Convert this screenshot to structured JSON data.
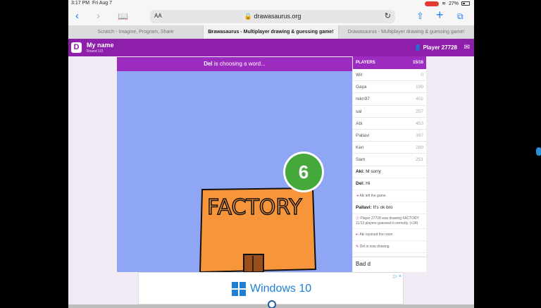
{
  "statusbar": {
    "time": "3:17 PM",
    "date": "Fri Aug 7",
    "battery": "27%"
  },
  "toolbar": {
    "aa": "AA",
    "url": "drawasaurus.org"
  },
  "tabs": [
    {
      "label": "Scratch - Imagine, Program, Share"
    },
    {
      "label": "Drawasaurus - Multiplayer drawing & guessing game!"
    },
    {
      "label": "Drawasaurus - Multiplayer drawing & guessing game!"
    }
  ],
  "app": {
    "my_name": "My name",
    "round": "Round 1/3",
    "player": "Player 27728"
  },
  "game": {
    "drawer": "Del",
    "choosing": " is choosing a word...",
    "timer": "6",
    "drawing_text": "FACTORY",
    "guess_input": "Bad d"
  },
  "players": {
    "header": "PLAYERS",
    "count": "15/16",
    "list": [
      {
        "name": "Wil",
        "score": "0"
      },
      {
        "name": "Gaya",
        "score": "199"
      },
      {
        "name": "rekn97",
        "score": "402"
      },
      {
        "name": "sal",
        "score": "257"
      },
      {
        "name": "Abi",
        "score": "453"
      },
      {
        "name": "Pallavi",
        "score": "397"
      },
      {
        "name": "Ken",
        "score": "289"
      },
      {
        "name": "Sam",
        "score": "251"
      }
    ]
  },
  "chat": [
    {
      "user": "Aki:",
      "text": " M sorry"
    },
    {
      "user": "Del:",
      "text": " Hi"
    },
    {
      "system": "Aki left the game."
    },
    {
      "user": "Pallavi:",
      "text": " It's ok bro"
    },
    {
      "system": "Player 27728 was drawing FACTORY. 11/13 players guessed it correctly. (+34)"
    },
    {
      "system": "Aki rejoined the room"
    },
    {
      "system": "Del is now drawing"
    }
  ],
  "ad": {
    "badge": "▷ ×",
    "text": "Windows 10"
  },
  "colors": {
    "brand_purple": "#8d1fab",
    "canvas_bg": "#8fa6f4",
    "timer_green": "#44a83a",
    "box_orange": "#f7953a"
  }
}
